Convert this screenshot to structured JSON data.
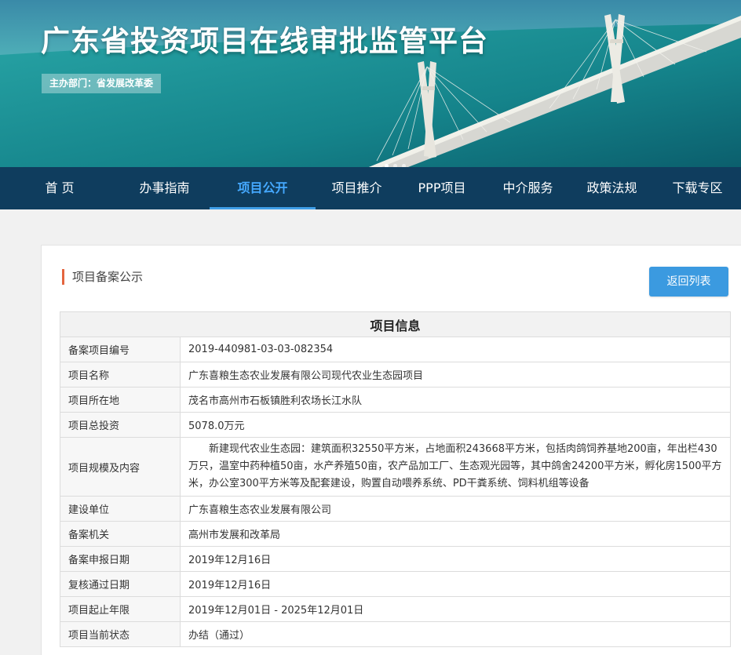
{
  "header": {
    "site_title": "广东省投资项目在线审批监管平台",
    "sponsor": "主办部门：省发展改革委",
    "slides": 3,
    "active_slide": 1
  },
  "nav": {
    "items": [
      {
        "label": "首 页"
      },
      {
        "label": "办事指南"
      },
      {
        "label": "项目公开",
        "active": true
      },
      {
        "label": "项目推介"
      },
      {
        "label": "PPP项目"
      },
      {
        "label": "中介服务"
      },
      {
        "label": "政策法规"
      },
      {
        "label": "下载专区"
      }
    ]
  },
  "panel": {
    "section_title": "项目备案公示",
    "back_button": "返回列表",
    "table_header": "项目信息",
    "rows": [
      {
        "label": "备案项目编号",
        "value": "2019-440981-03-03-082354"
      },
      {
        "label": "项目名称",
        "value": "广东喜粮生态农业发展有限公司现代农业生态园项目"
      },
      {
        "label": "项目所在地",
        "value": "茂名市高州市石板镇胜利农场长江水队"
      },
      {
        "label": "项目总投资",
        "value": "5078.0万元"
      },
      {
        "label": "项目规模及内容",
        "value": "新建现代农业生态园：建筑面积32550平方米，占地面积243668平方米，包括肉鸽饲养基地200亩，年出栏430万只，温室中药种植50亩，水产养殖50亩，农产品加工厂、生态观光园等，其中鸽舍24200平方米，孵化房1500平方米，办公室300平方米等及配套建设，购置自动喂养系统、PD干粪系统、饲料机组等设备"
      },
      {
        "label": "建设单位",
        "value": "广东喜粮生态农业发展有限公司"
      },
      {
        "label": "备案机关",
        "value": "高州市发展和改革局"
      },
      {
        "label": "备案申报日期",
        "value": "2019年12月16日"
      },
      {
        "label": "复核通过日期",
        "value": "2019年12月16日"
      },
      {
        "label": "项目起止年限",
        "value": "2019年12月01日 - 2025年12月01日"
      },
      {
        "label": "项目当前状态",
        "value": "办结（通过）"
      }
    ]
  },
  "colors": {
    "nav_bg": "#0f3d5e",
    "nav_active": "#45a9ff",
    "button": "#3b9ae0",
    "section_accent": "#e4653f"
  }
}
